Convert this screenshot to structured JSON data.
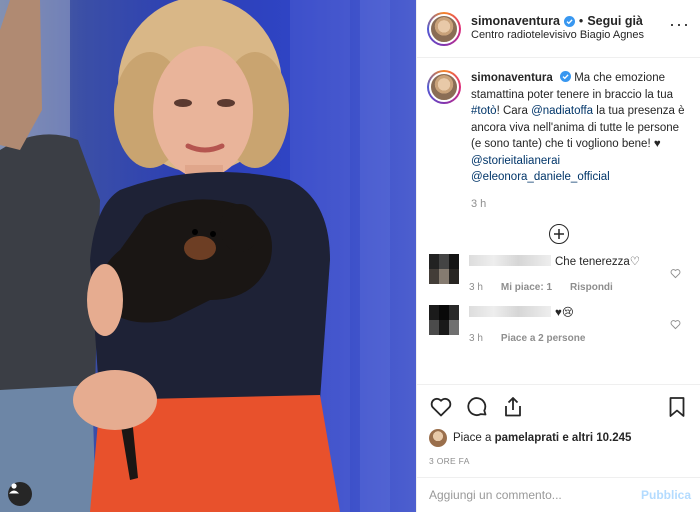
{
  "post": {
    "username": "simonaventura",
    "follow_label": "Segui già",
    "dot": "•",
    "location": "Centro radiotelevisivo Biagio Agnes",
    "more": "···"
  },
  "caption": {
    "username": "simonaventura",
    "text_1": "Ma che emozione stamattina poter tenere in braccio la tua ",
    "hashtag": "#totò",
    "text_2": "! Cara ",
    "mention_1": "@nadiatoffa",
    "text_3": " la tua presenza è ancora viva nell'anima di tutte le persone (e sono tante) che ti vogliono bene! ♥ ",
    "mention_2": "@storieitalianerai",
    "mention_3": "@eleonora_daniele_official",
    "time": "3 h"
  },
  "comments": [
    {
      "text": "Che tenerezza♡",
      "time": "3 h",
      "likes": "Mi piace: 1",
      "reply": "Rispondi"
    },
    {
      "text": "♥😢",
      "time": "3 h",
      "likes": "Piace a 2 persone"
    }
  ],
  "likes": {
    "prefix": "Piace a ",
    "user": "pamelaprati",
    "suffix": " e altri 10.245"
  },
  "time_ago": "3 ORE FA",
  "add_comment": {
    "placeholder": "Aggiungi un commento...",
    "publish": "Pubblica"
  },
  "colors": {
    "link": "#003569",
    "muted": "#8e8e8e",
    "verified": "#3897f0",
    "publish_disabled": "#b3dbff",
    "photo_background": "#2f44c4",
    "skirt": "#e8512c"
  }
}
